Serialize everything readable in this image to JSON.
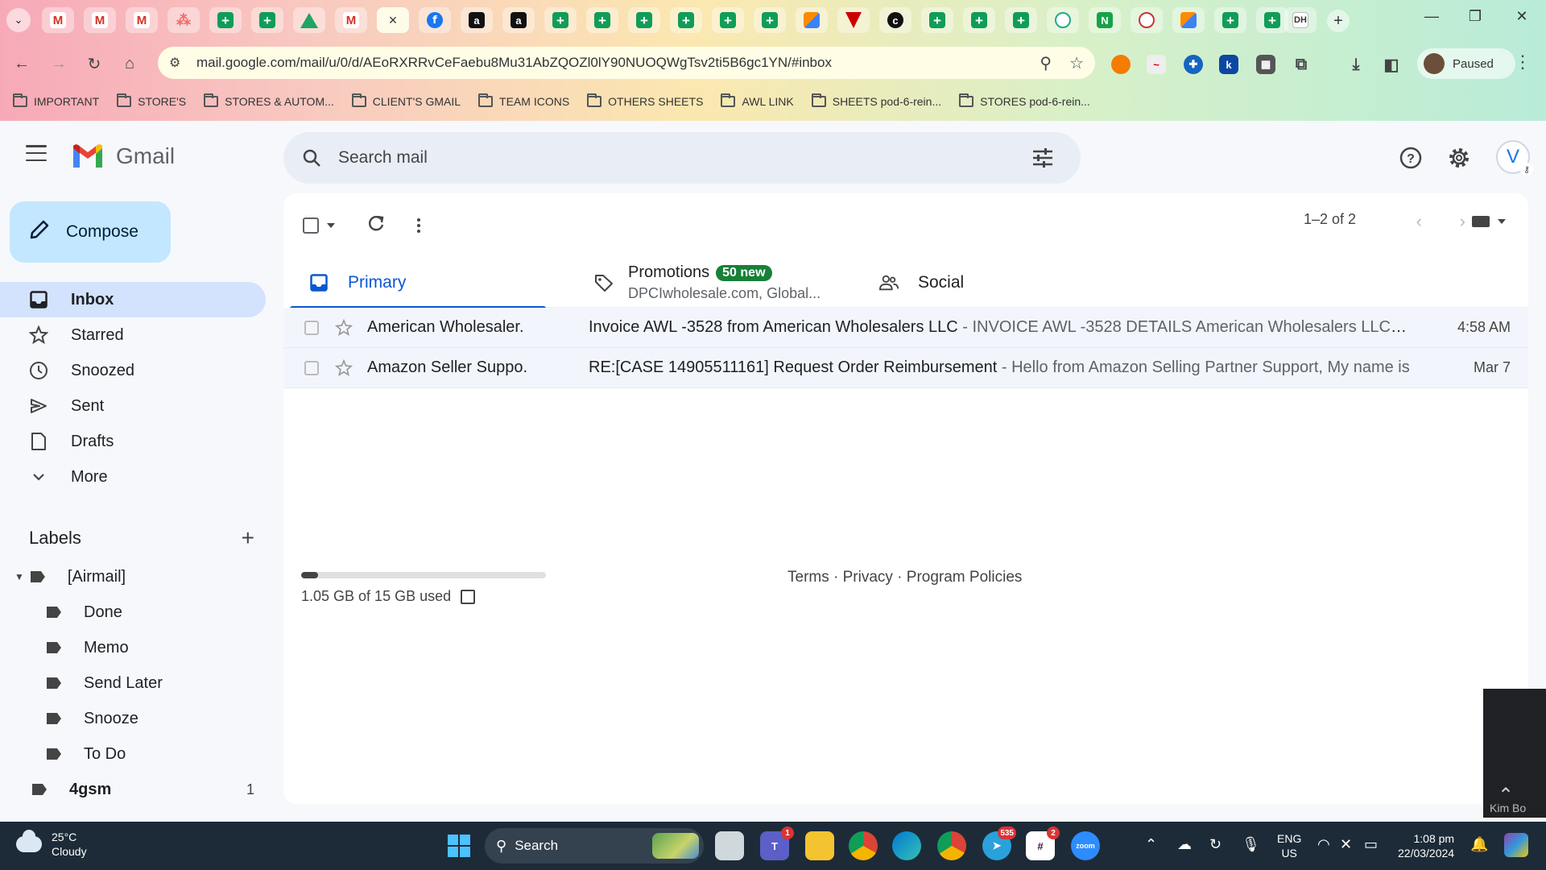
{
  "browser": {
    "active_tab_close": "×",
    "new_tab": "+",
    "url": "mail.google.com/mail/u/0/d/AEoRXRRvCeFaebu8Mu31AbZQOZl0lY90NUOQWgTsv2ti5B6gc1YN/#inbox",
    "profile_status": "Paused",
    "bookmarks": [
      "IMPORTANT",
      "STORE'S",
      "STORES & AUTOM...",
      "CLIENT'S GMAIL",
      "TEAM ICONS",
      "OTHERS SHEETS",
      "AWL LINK",
      "SHEETS pod-6-rein...",
      "STORES pod-6-rein..."
    ]
  },
  "gmail": {
    "logo_text": "Gmail",
    "search_placeholder": "Search mail",
    "avatar_initial": "V",
    "compose_label": "Compose",
    "nav": [
      {
        "label": "Inbox"
      },
      {
        "label": "Starred"
      },
      {
        "label": "Snoozed"
      },
      {
        "label": "Sent"
      },
      {
        "label": "Drafts"
      },
      {
        "label": "More"
      }
    ],
    "labels_title": "Labels",
    "labels": [
      {
        "label": "[Airmail]"
      },
      {
        "label": "Done"
      },
      {
        "label": "Memo"
      },
      {
        "label": "Send Later"
      },
      {
        "label": "Snooze"
      },
      {
        "label": "To Do"
      },
      {
        "label": "4gsm",
        "count": "1"
      }
    ],
    "pager": "1–2 of 2",
    "tabs": {
      "primary": "Primary",
      "promotions": "Promotions",
      "promotions_badge": "50 new",
      "promotions_sub": "DPCIwholesale.com, Global...",
      "social": "Social"
    },
    "emails": [
      {
        "sender": "American Wholesaler.",
        "subject": "Invoice AWL -3528 from American Wholesalers LLC",
        "snippet": " - INVOICE AWL -3528 DETAILS American Wholesalers LLC American Wholesalers LLC",
        "date": "4:58 AM"
      },
      {
        "sender": "Amazon Seller Suppo.",
        "subject": "RE:[CASE 14905511161] Request Order Reimbursement",
        "snippet": " - Hello from Amazon Selling Partner Support, My name is",
        "date": "Mar 7"
      }
    ],
    "storage_text": "1.05 GB of 15 GB used",
    "storage_fraction": 0.07,
    "footer_links": "Terms · Privacy · Program Policies",
    "video_name": "Kim Bo"
  },
  "taskbar": {
    "temp": "25°C",
    "condition": "Cloudy",
    "search_label": "Search",
    "badges": {
      "teams": "1",
      "telegram": "535",
      "slack": "2"
    },
    "lang_1": "ENG",
    "lang_2": "US",
    "time": "1:08 pm",
    "date": "22/03/2024"
  },
  "colors": {
    "accent": "#0b57d0",
    "compose": "#c2e7ff",
    "active_nav": "#d3e3fd",
    "badge": "#188038"
  }
}
